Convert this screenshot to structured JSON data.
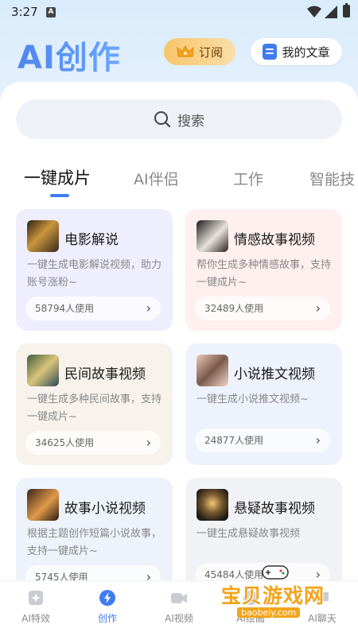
{
  "status_bar": {
    "time": "3:27",
    "notif_badge": "A"
  },
  "header": {
    "title": "AI创作",
    "subscribe_label": "订阅",
    "my_articles_label": "我的文章"
  },
  "search": {
    "placeholder": "搜索"
  },
  "tabs": [
    {
      "label": "一键成片",
      "active": true
    },
    {
      "label": "AI伴侣",
      "active": false
    },
    {
      "label": "工作",
      "active": false
    },
    {
      "label": "智能技",
      "active": false
    }
  ],
  "cards": [
    {
      "title": "电影解说",
      "description": "一键生成电影解说视频，助力账号涨粉~",
      "usage": "58794人使用",
      "bg_color": "#efeefe"
    },
    {
      "title": "情感故事视频",
      "description": "帮你生成多种情感故事，支持一键成片~",
      "usage": "32489人使用",
      "bg_color": "#fdf0ef"
    },
    {
      "title": "民间故事视频",
      "description": "一键生成多种民间故事，支持一键成片~",
      "usage": "34625人使用",
      "bg_color": "#f7f3ec"
    },
    {
      "title": "小说推文视频",
      "description": "一键生成小说推文视频~",
      "usage": "24877人使用",
      "bg_color": "#eef2fc"
    },
    {
      "title": "故事小说视频",
      "description": "根据主题创作短篇小说故事，支持一键成片~",
      "usage": "5745人使用",
      "bg_color": "#eef3fb"
    },
    {
      "title": "悬疑故事视频",
      "description": "一键生成悬疑故事视频",
      "usage": "45484人使用",
      "bg_color": "#f1f2f6"
    }
  ],
  "bottom_nav": [
    {
      "label": "AI特效",
      "icon": "sparkle-icon",
      "active": false
    },
    {
      "label": "创作",
      "icon": "lightning-icon",
      "active": true
    },
    {
      "label": "AI视频",
      "icon": "video-camera-icon",
      "active": false
    },
    {
      "label": "AI绘画",
      "icon": "palette-icon",
      "active": false
    },
    {
      "label": "AI聊天",
      "icon": "chat-icon",
      "active": false
    }
  ],
  "watermark": {
    "text": "宝贝游戏网",
    "url": "baobeiy.com"
  },
  "colors": {
    "accent": "#3f7cf0",
    "title_gradient_start": "#4f86ee",
    "subscribe_gold": "#f7c56a"
  }
}
